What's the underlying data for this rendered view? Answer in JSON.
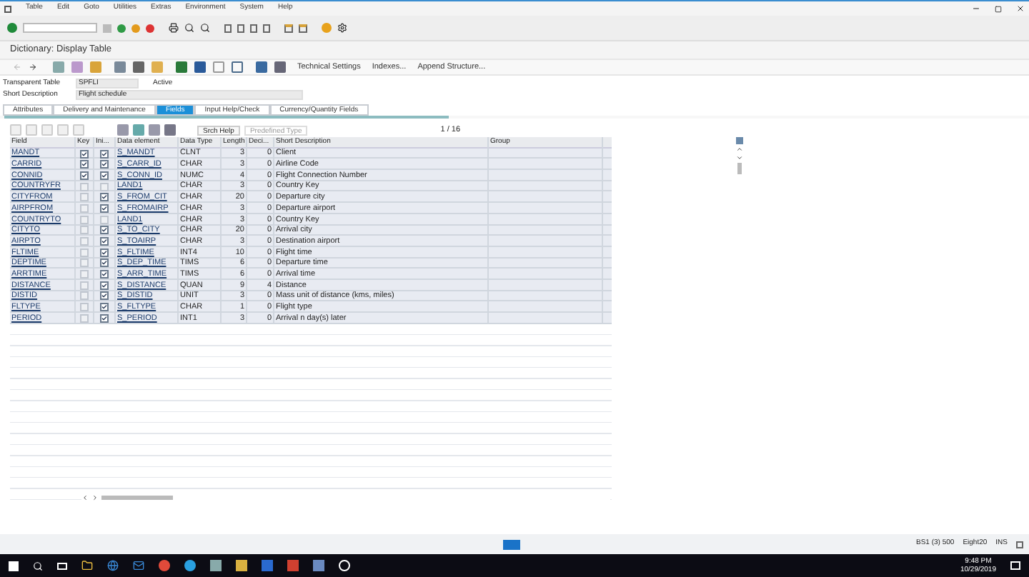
{
  "menu": [
    "Table",
    "Edit",
    "Goto",
    "Utilities",
    "Extras",
    "Environment",
    "System",
    "Help"
  ],
  "title": "Dictionary: Display Table",
  "app_toolbar": [
    "Technical Settings",
    "Indexes...",
    "Append Structure..."
  ],
  "header_fields": [
    {
      "label": "Transparent Table",
      "value": "SPFLI",
      "status": "Active"
    },
    {
      "label": "Short Description",
      "value": "Flight schedule"
    }
  ],
  "tabs": [
    {
      "label": "Attributes",
      "selected": false
    },
    {
      "label": "Delivery and Maintenance",
      "selected": false
    },
    {
      "label": "Fields",
      "selected": true
    },
    {
      "label": "Input Help/Check",
      "selected": false
    },
    {
      "label": "Currency/Quantity Fields",
      "selected": false
    }
  ],
  "table_toolbar": {
    "buttons": [
      "Srch Help",
      "Predefined Type"
    ],
    "page": "1 / 16"
  },
  "columns": [
    "Field",
    "Key",
    "Ini...",
    "Data element",
    "Data Type",
    "Length",
    "Deci...",
    "Short Description",
    "Group"
  ],
  "rows": [
    {
      "field": "MANDT",
      "key": true,
      "initial": true,
      "data_element": "S_MANDT",
      "data_type": "CLNT",
      "length": "3",
      "decimals": "0",
      "description": "Client"
    },
    {
      "field": "CARRID",
      "key": true,
      "initial": true,
      "data_element": "S_CARR_ID",
      "data_type": "CHAR",
      "length": "3",
      "decimals": "0",
      "description": "Airline Code"
    },
    {
      "field": "CONNID",
      "key": true,
      "initial": true,
      "data_element": "S_CONN_ID",
      "data_type": "NUMC",
      "length": "4",
      "decimals": "0",
      "description": "Flight Connection Number"
    },
    {
      "field": "COUNTRYFR",
      "key": false,
      "initial": false,
      "data_element": "LAND1",
      "data_type": "CHAR",
      "length": "3",
      "decimals": "0",
      "description": "Country Key"
    },
    {
      "field": "CITYFROM",
      "key": false,
      "initial": true,
      "data_element": "S_FROM_CIT",
      "data_type": "CHAR",
      "length": "20",
      "decimals": "0",
      "description": "Departure city"
    },
    {
      "field": "AIRPFROM",
      "key": false,
      "initial": true,
      "data_element": "S_FROMAIRP",
      "data_type": "CHAR",
      "length": "3",
      "decimals": "0",
      "description": "Departure airport"
    },
    {
      "field": "COUNTRYTO",
      "key": false,
      "initial": false,
      "data_element": "LAND1",
      "data_type": "CHAR",
      "length": "3",
      "decimals": "0",
      "description": "Country Key"
    },
    {
      "field": "CITYTO",
      "key": false,
      "initial": true,
      "data_element": "S_TO_CITY",
      "data_type": "CHAR",
      "length": "20",
      "decimals": "0",
      "description": "Arrival city"
    },
    {
      "field": "AIRPTO",
      "key": false,
      "initial": true,
      "data_element": "S_TOAIRP",
      "data_type": "CHAR",
      "length": "3",
      "decimals": "0",
      "description": "Destination airport"
    },
    {
      "field": "FLTIME",
      "key": false,
      "initial": true,
      "data_element": "S_FLTIME",
      "data_type": "INT4",
      "length": "10",
      "decimals": "0",
      "description": "Flight time"
    },
    {
      "field": "DEPTIME",
      "key": false,
      "initial": true,
      "data_element": "S_DEP_TIME",
      "data_type": "TIMS",
      "length": "6",
      "decimals": "0",
      "description": "Departure time"
    },
    {
      "field": "ARRTIME",
      "key": false,
      "initial": true,
      "data_element": "S_ARR_TIME",
      "data_type": "TIMS",
      "length": "6",
      "decimals": "0",
      "description": "Arrival time"
    },
    {
      "field": "DISTANCE",
      "key": false,
      "initial": true,
      "data_element": "S_DISTANCE",
      "data_type": "QUAN",
      "length": "9",
      "decimals": "4",
      "description": "Distance"
    },
    {
      "field": "DISTID",
      "key": false,
      "initial": true,
      "data_element": "S_DISTID",
      "data_type": "UNIT",
      "length": "3",
      "decimals": "0",
      "description": "Mass unit of distance (kms, miles)"
    },
    {
      "field": "FLTYPE",
      "key": false,
      "initial": true,
      "data_element": "S_FLTYPE",
      "data_type": "CHAR",
      "length": "1",
      "decimals": "0",
      "description": "Flight type"
    },
    {
      "field": "PERIOD",
      "key": false,
      "initial": true,
      "data_element": "S_PERIOD",
      "data_type": "INT1",
      "length": "3",
      "decimals": "0",
      "description": "Arrival n day(s) later"
    }
  ],
  "status_bar": {
    "system": "BS1 (3) 500",
    "server": "Eight20",
    "mode": "INS"
  },
  "taskbar": {
    "time": "9:48 PM",
    "date": "10/29/2019"
  }
}
